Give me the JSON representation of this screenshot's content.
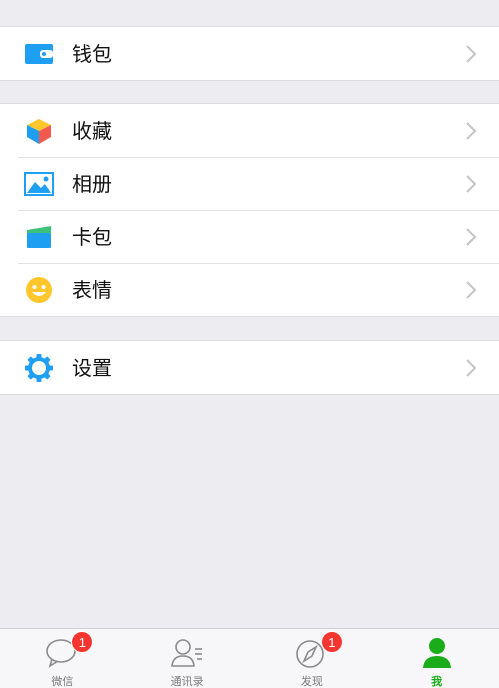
{
  "groups": [
    {
      "items": [
        {
          "label": "钱包",
          "icon": "wallet-icon"
        }
      ]
    },
    {
      "items": [
        {
          "label": "收藏",
          "icon": "favorites-cube-icon"
        },
        {
          "label": "相册",
          "icon": "album-photo-icon"
        },
        {
          "label": "卡包",
          "icon": "card-package-icon"
        },
        {
          "label": "表情",
          "icon": "smiley-face-icon"
        }
      ]
    },
    {
      "items": [
        {
          "label": "设置",
          "icon": "settings-gear-icon"
        }
      ]
    }
  ],
  "tabbar": {
    "tabs": [
      {
        "label": "微信",
        "icon": "chat-bubble-icon",
        "badge": "1",
        "active": false
      },
      {
        "label": "通讯录",
        "icon": "contacts-icon",
        "badge": "",
        "active": false
      },
      {
        "label": "发现",
        "icon": "compass-icon",
        "badge": "1",
        "active": false
      },
      {
        "label": "我",
        "icon": "person-icon",
        "badge": "",
        "active": true
      }
    ]
  },
  "colors": {
    "background": "#ECECF1",
    "accent_green": "#1AAD19",
    "badge_red": "#F43530",
    "icon_blue": "#1E9FF2"
  }
}
